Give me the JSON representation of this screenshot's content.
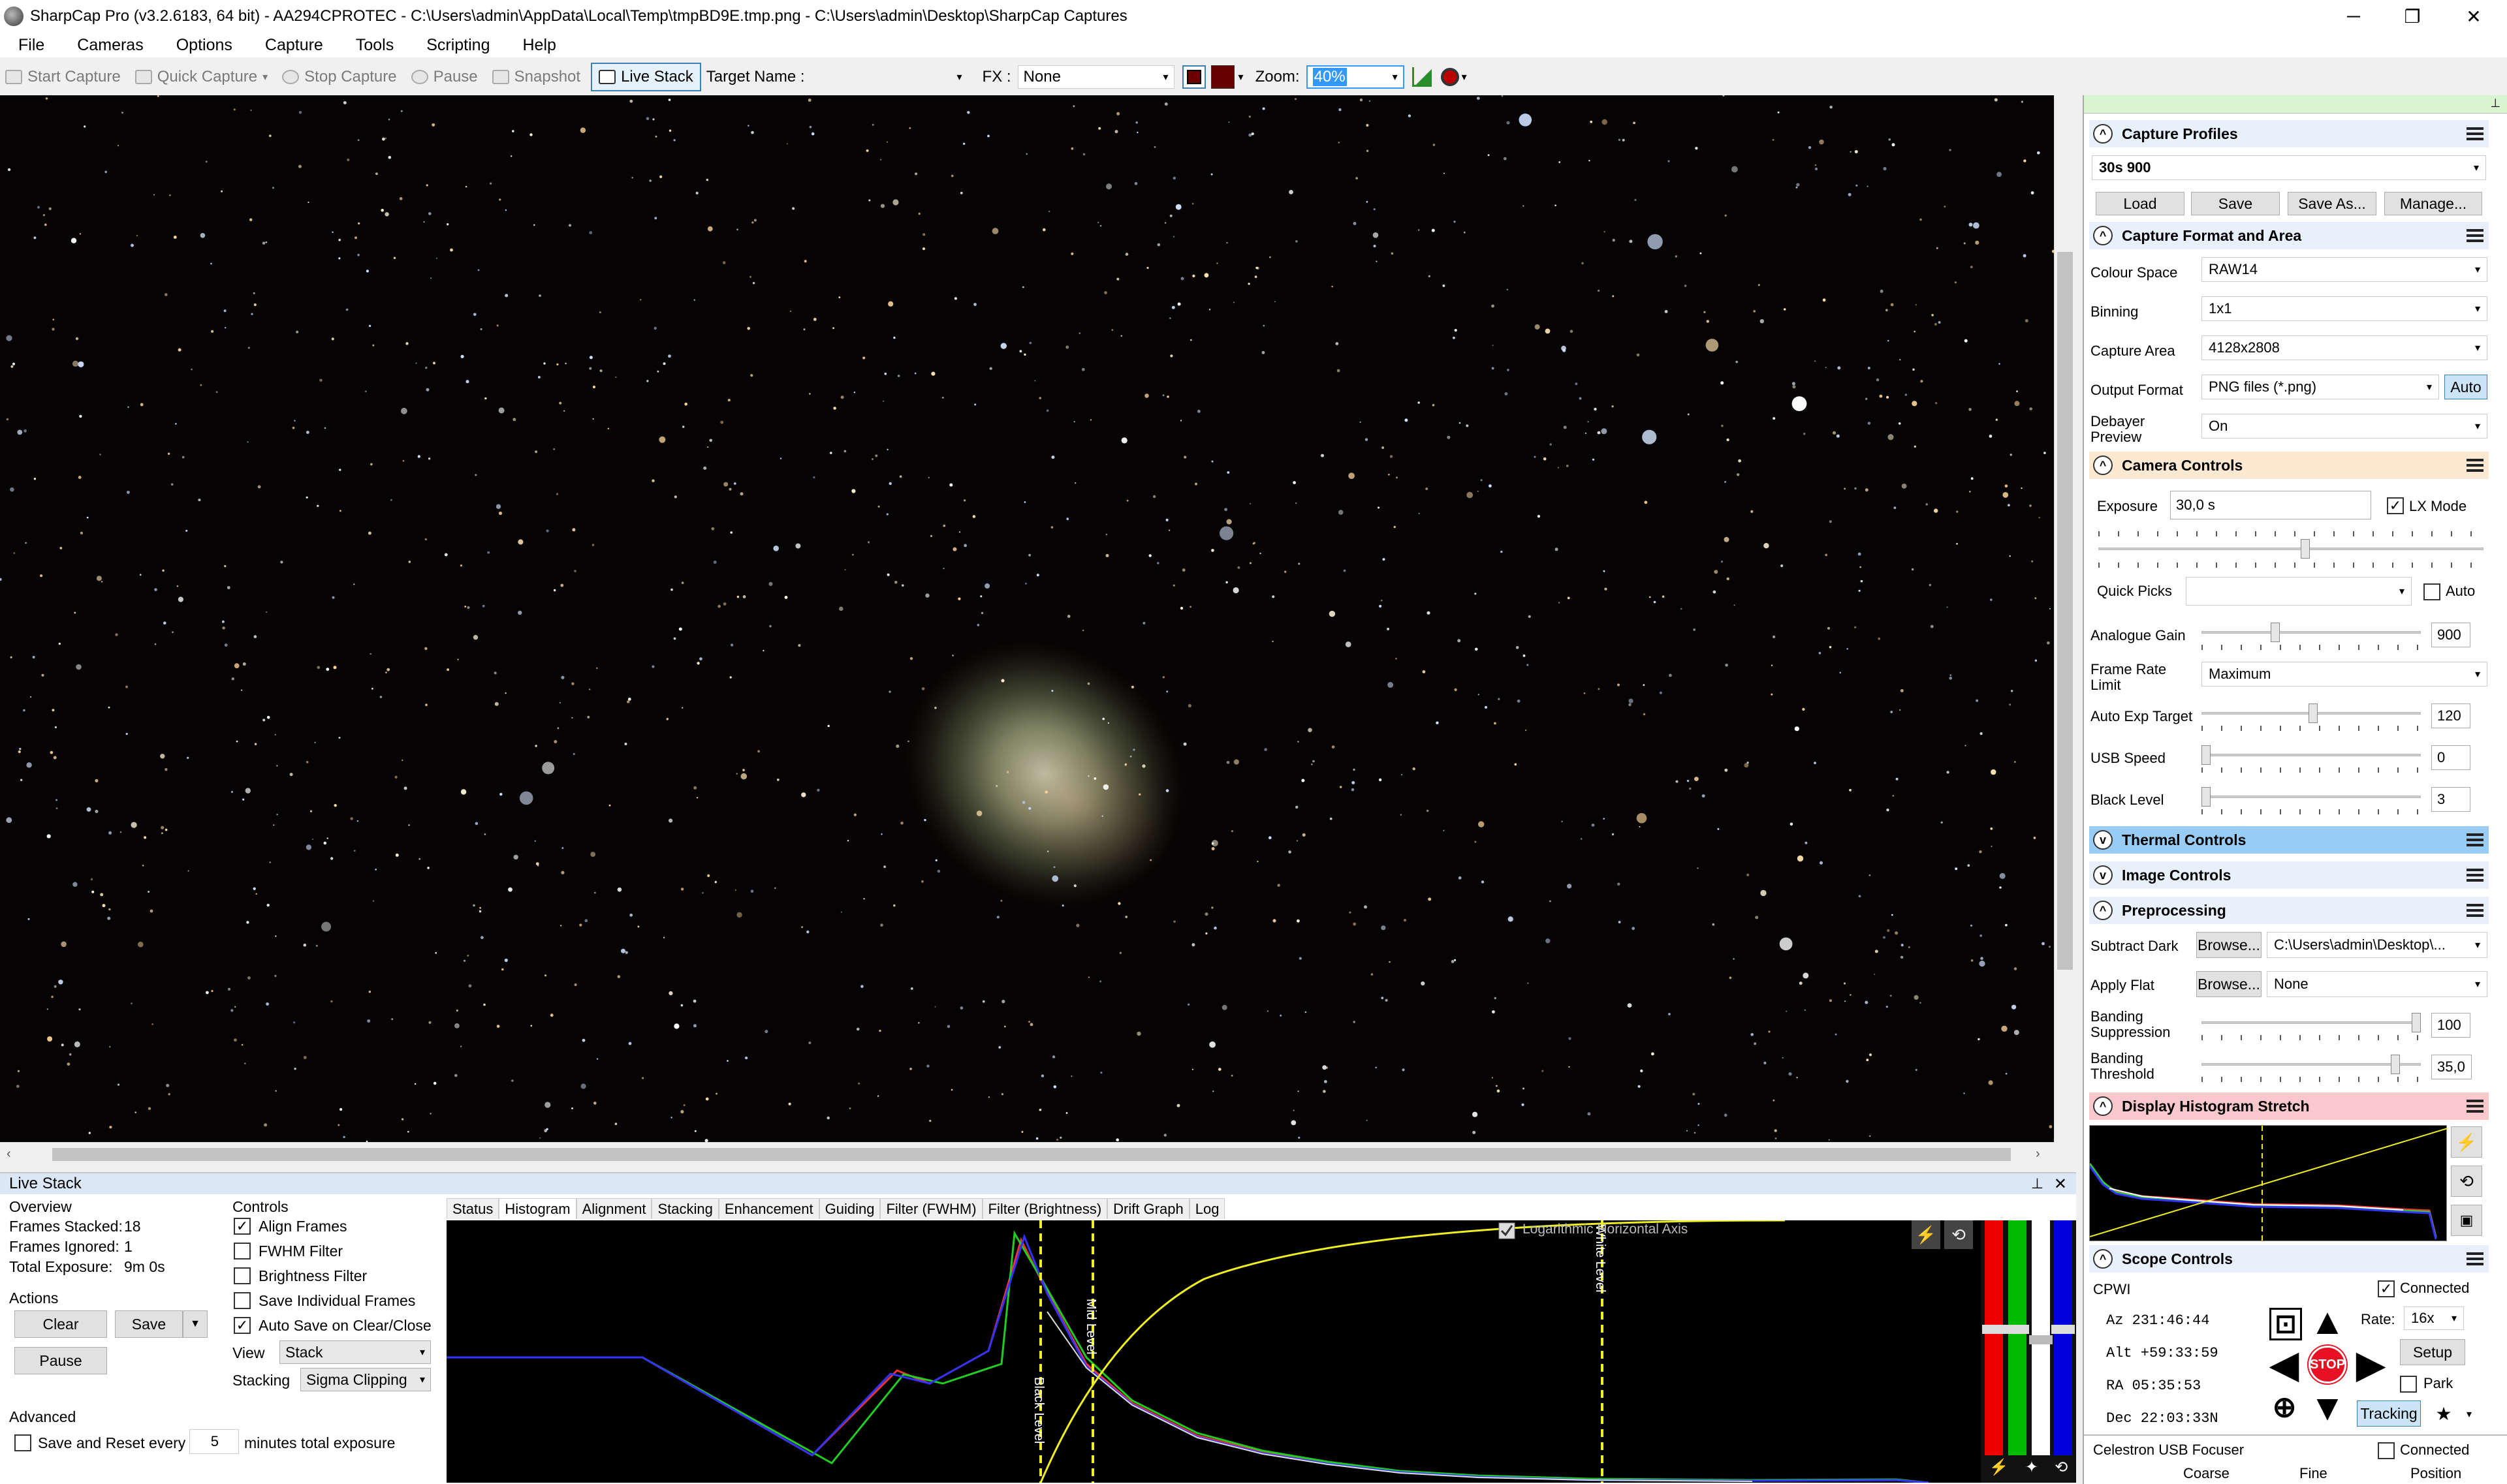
{
  "window": {
    "title": "SharpCap Pro (v3.2.6183, 64 bit) - AA294CPROTEC - C:\\Users\\admin\\AppData\\Local\\Temp\\tmpBD9E.tmp.png - C:\\Users\\admin\\Desktop\\SharpCap Captures",
    "minimize": "─",
    "restore": "❐",
    "close": "✕"
  },
  "menu": [
    "File",
    "Cameras",
    "Options",
    "Capture",
    "Tools",
    "Scripting",
    "Help"
  ],
  "toolbar": {
    "start": "Start Capture",
    "quick": "Quick Capture",
    "stop": "Stop Capture",
    "pause": "Pause",
    "snapshot": "Snapshot",
    "livestack": "Live Stack",
    "target_label": "Target Name :",
    "target_value": "",
    "fx_label": "FX :",
    "fx_value": "None",
    "zoom_label": "Zoom:",
    "zoom_value": "40%"
  },
  "livestack": {
    "title": "Live Stack",
    "overview_label": "Overview",
    "frames_stacked_label": "Frames Stacked:",
    "frames_stacked": "18",
    "frames_ignored_label": "Frames Ignored:",
    "frames_ignored": "1",
    "total_exposure_label": "Total Exposure:",
    "total_exposure": "9m 0s",
    "actions_label": "Actions",
    "clear": "Clear",
    "save": "Save",
    "pause": "Pause",
    "advanced_label": "Advanced",
    "save_reset": "Save and Reset every",
    "save_reset_value": "5",
    "save_reset_suffix": "minutes total exposure",
    "controls_label": "Controls",
    "align": "Align Frames",
    "fwhm": "FWHM Filter",
    "brightness": "Brightness Filter",
    "save_individual": "Save Individual Frames",
    "auto_save": "Auto Save on Clear/Close",
    "view_label": "View",
    "view_value": "Stack",
    "stacking_label": "Stacking",
    "stacking_value": "Sigma Clipping",
    "tabs": [
      "Status",
      "Histogram",
      "Alignment",
      "Stacking",
      "Enhancement",
      "Guiding",
      "Filter (FWHM)",
      "Filter (Brightness)",
      "Drift Graph",
      "Log"
    ],
    "hist_log_label": "Logarithmic Horizontal Axis",
    "black_level": "Black Level",
    "mid_level": "Mid Level",
    "white_level": "White Level"
  },
  "capture_profiles": {
    "title": "Capture Profiles",
    "profile": "30s 900",
    "load": "Load",
    "save": "Save",
    "save_as": "Save As...",
    "manage": "Manage..."
  },
  "capture_format": {
    "title": "Capture Format and Area",
    "colour_space_label": "Colour Space",
    "colour_space": "RAW14",
    "binning_label": "Binning",
    "binning": "1x1",
    "capture_area_label": "Capture Area",
    "capture_area": "4128x2808",
    "output_format_label": "Output Format",
    "output_format": "PNG files (*.png)",
    "auto": "Auto",
    "debayer_label": "Debayer Preview",
    "debayer": "On"
  },
  "camera_controls": {
    "title": "Camera Controls",
    "exposure_label": "Exposure",
    "exposure": "30,0 s",
    "lx_mode": "LX Mode",
    "quick_picks_label": "Quick Picks",
    "quick_picks": "",
    "auto": "Auto",
    "gain_label": "Analogue Gain",
    "gain": "900",
    "frame_rate_label": "Frame Rate Limit",
    "frame_rate": "Maximum",
    "auto_exp_label": "Auto Exp Target",
    "auto_exp": "120",
    "usb_label": "USB Speed",
    "usb": "0",
    "black_label": "Black Level",
    "black": "3"
  },
  "thermal": {
    "title": "Thermal Controls"
  },
  "image_controls": {
    "title": "Image Controls"
  },
  "preprocessing": {
    "title": "Preprocessing",
    "dark_label": "Subtract Dark",
    "browse": "Browse...",
    "dark_value": "C:\\Users\\admin\\Desktop\\...",
    "flat_label": "Apply Flat",
    "flat_value": "None",
    "banding_supp_label": "Banding Suppression",
    "banding_supp": "100",
    "banding_thr_label": "Banding Threshold",
    "banding_thr": "35,0"
  },
  "display_stretch": {
    "title": "Display Histogram Stretch"
  },
  "scope": {
    "title": "Scope Controls",
    "name": "CPWI",
    "connected": "Connected",
    "az": "Az  231:46:44",
    "alt": "Alt +59:33:59",
    "ra": "RA  05:35:53",
    "dec": "Dec 22:03:33N",
    "rate_label": "Rate:",
    "rate": "16x",
    "setup": "Setup",
    "park": "Park",
    "tracking": "Tracking",
    "stop": "STOP"
  },
  "focuser": {
    "name": "Celestron USB Focuser",
    "connected": "Connected",
    "coarse": "Coarse",
    "fine": "Fine",
    "position": "Position"
  },
  "colors": {
    "accent": "#3399ff",
    "camera_header": "#fde9d2",
    "thermal_header": "#99ccf5",
    "stretch_header": "#f8c8cc",
    "stop": "#e81123"
  }
}
